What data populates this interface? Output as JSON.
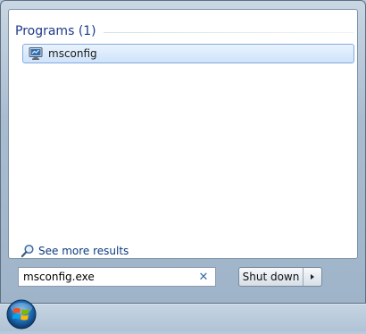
{
  "start_menu": {
    "results": {
      "group_title": "Programs (1)",
      "items": [
        {
          "label": "msconfig",
          "icon": "system-configuration-icon"
        }
      ]
    },
    "see_more": {
      "label": "See more results",
      "icon": "search-magnifier-icon"
    },
    "search": {
      "value": "msconfig.exe",
      "clear_icon": "clear-x-icon"
    },
    "shutdown": {
      "label": "Shut down",
      "arrow_icon": "triangle-right-icon"
    }
  },
  "taskbar": {
    "start_button": "windows-start-orb"
  },
  "colors": {
    "group_title": "#1e3a8a",
    "link": "#0b3a7e",
    "selected_item_border": "#84acdd",
    "selected_item_fill": "#dcebfc"
  }
}
